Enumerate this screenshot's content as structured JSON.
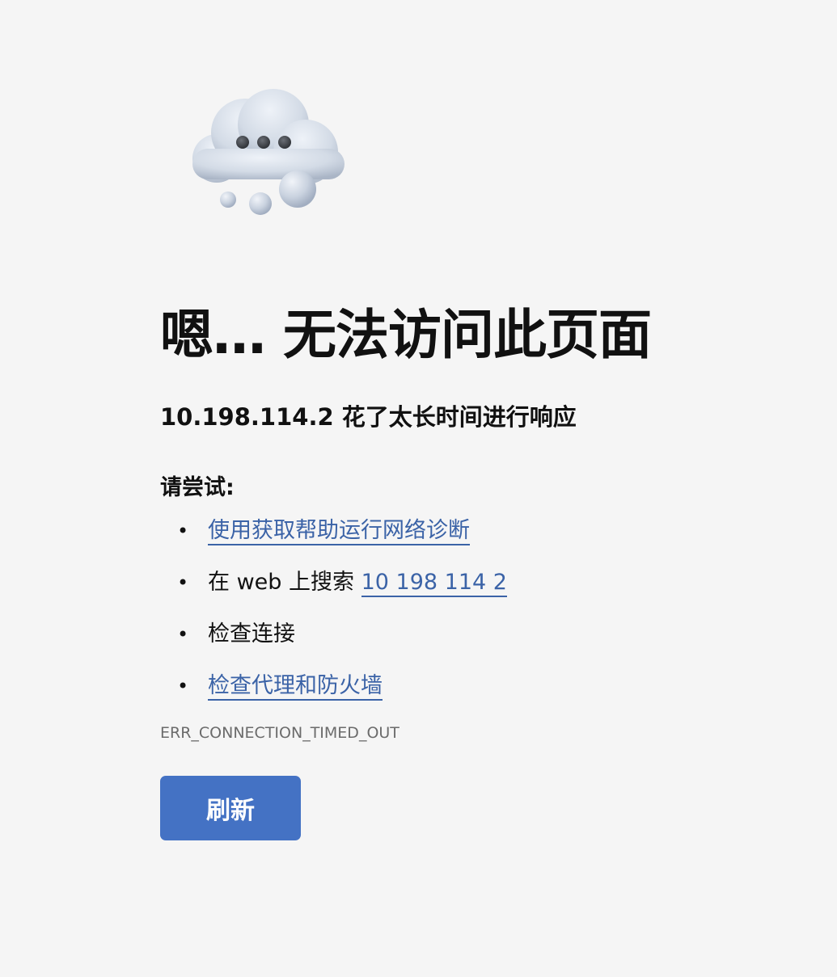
{
  "error_page": {
    "illustration_icon": "cloud-ellipsis-icon",
    "title": "嗯… 无法访问此页面",
    "subtitle": "10.198.114.2 花了太长时间进行响应",
    "try_heading": "请尝试:",
    "suggestions": {
      "diagnostics_link": "使用获取帮助运行网络诊断",
      "search_prefix": "在 web 上搜索 ",
      "search_link": "10 198 114 2",
      "check_connection": "检查连接",
      "proxy_firewall_link": "检查代理和防火墙"
    },
    "bullet": "•",
    "error_code": "ERR_CONNECTION_TIMED_OUT",
    "refresh_label": "刷新"
  },
  "colors": {
    "background": "#f5f5f5",
    "link": "#3b63a7",
    "button": "#4472c4",
    "error_code_text": "#6b6b6b"
  }
}
